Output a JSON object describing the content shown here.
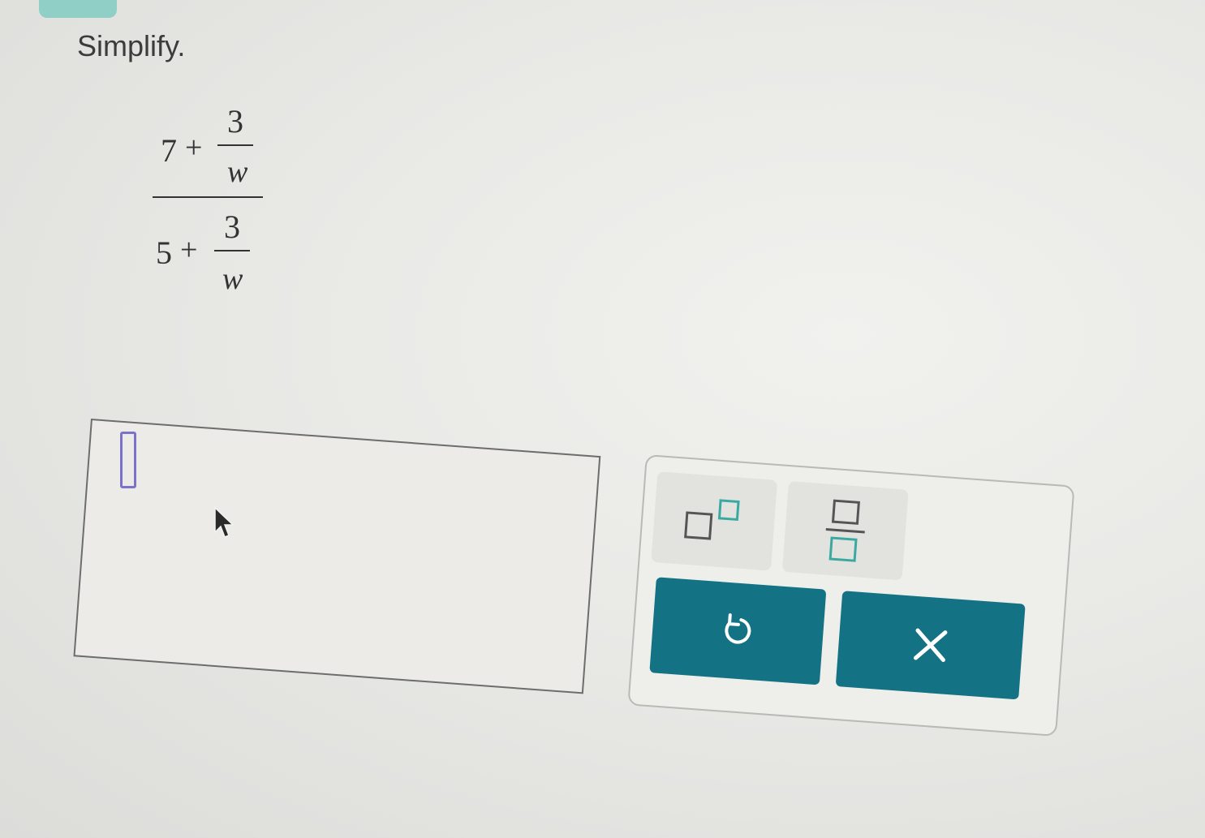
{
  "question": {
    "prompt": "Simplify."
  },
  "expression": {
    "numerator": {
      "whole": "7",
      "op": "+",
      "frac_num": "3",
      "frac_den": "w"
    },
    "denominator": {
      "whole": "5",
      "op": "+",
      "frac_num": "3",
      "frac_den": "w"
    }
  },
  "answer": {
    "value": ""
  },
  "keypad": {
    "keys": [
      {
        "name": "exponent",
        "icon": "exponent-icon"
      },
      {
        "name": "fraction",
        "icon": "fraction-icon"
      },
      {
        "name": "undo",
        "icon": "undo-icon"
      },
      {
        "name": "clear",
        "icon": "close-icon"
      }
    ],
    "accent_color": "#137384",
    "template_color": "#3aa9a2"
  }
}
